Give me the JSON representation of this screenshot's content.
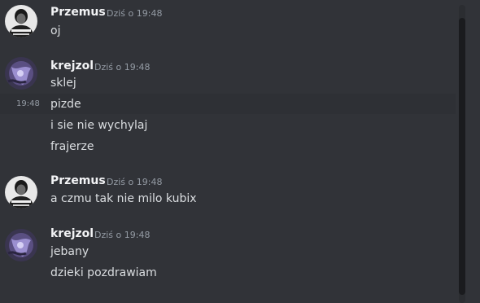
{
  "messages": [
    {
      "author": "Przemus",
      "timestamp": "Dziś o 19:48",
      "lines": [
        "oj"
      ]
    },
    {
      "author": "krejzol",
      "timestamp": "Dziś o 19:48",
      "lines": [
        "sklej",
        "pizde",
        "i sie nie wychylaj",
        "frajerze"
      ],
      "hover_time": "19:48"
    },
    {
      "author": "Przemus",
      "timestamp": "Dziś o 19:48",
      "lines": [
        "a czmu tak nie milo kubix"
      ]
    },
    {
      "author": "krejzol",
      "timestamp": "Dziś o 19:48",
      "lines": [
        "jebany",
        "dzieki pozdrawiam"
      ]
    }
  ],
  "colors": {
    "background": "#313338",
    "username": "#f2f3f5",
    "text": "#dbdee1",
    "muted": "#949ba4"
  },
  "avatars": {
    "przemus": "person-photo-avatar",
    "krejzol": "purple-abstract-avatar"
  }
}
